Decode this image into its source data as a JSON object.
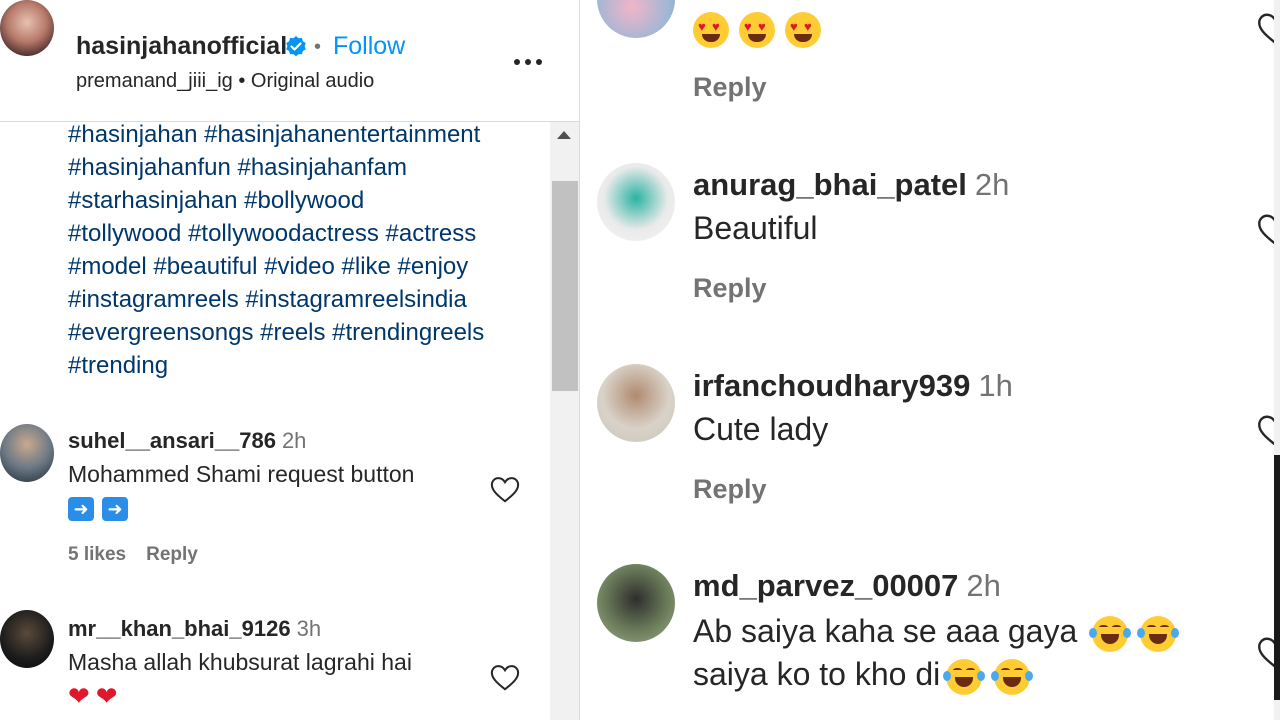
{
  "post": {
    "username": "hasinjahanofficial",
    "separator": "•",
    "follow_label": "Follow",
    "audio": "premanand_jiii_ig • Original audio",
    "caption_lines": [
      "#hasinjahan #hasinjahanentertainment",
      "#hasinjahanfun #hasinjahanfam",
      "#starhasinjahan #bollywood",
      "#tollywood #tollywoodactress #actress",
      "#model #beautiful #video #like #enjoy",
      "#instagramreels #instagramreelsindia",
      "#evergreensongs #reels #trendingreels",
      "#trending"
    ]
  },
  "left_comments": [
    {
      "username": "suhel__ansari__786",
      "time": "2h",
      "text": "Mohammed Shami request button",
      "emoji": [
        "➡️",
        "➡️"
      ],
      "likes": "5 likes",
      "reply": "Reply"
    },
    {
      "username": "mr__khan_bhai_9126",
      "time": "3h",
      "text": "Masha allah khubsurat lagrahi hai",
      "emoji": [
        "❤️",
        "❤️"
      ]
    }
  ],
  "right_comments": [
    {
      "username": "",
      "time": "",
      "text": "",
      "emoji_count": 3,
      "reply": "Reply"
    },
    {
      "username": "anurag_bhai_patel",
      "time": "2h",
      "text": "Beautiful",
      "reply": "Reply"
    },
    {
      "username": "irfanchoudhary939",
      "time": "1h",
      "text": "Cute lady",
      "reply": "Reply"
    },
    {
      "username": "md_parvez_00007",
      "time": "2h",
      "text_line1": "Ab saiya kaha se aaa gaya",
      "text_line2": "saiya ko to kho di"
    }
  ],
  "colors": {
    "link": "#00376b",
    "follow": "#0095f6",
    "verified": "#0095f6",
    "muted": "#737373"
  },
  "icons": [
    "verified-badge-icon",
    "more-options-icon",
    "heart-icon",
    "scroll-up-arrow-icon"
  ]
}
